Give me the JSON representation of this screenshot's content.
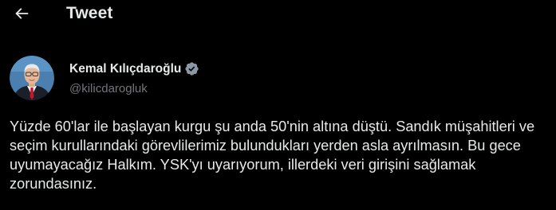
{
  "header": {
    "back_icon": "arrow-left-icon",
    "title": "Tweet"
  },
  "author": {
    "display_name": "Kemal Kılıçdaroğlu",
    "handle": "@kilicdarogluk",
    "verified_icon": "verified-badge-icon",
    "verified_color": "#8b98a5",
    "avatar_icon": "profile-photo"
  },
  "tweet": {
    "text": "Yüzde 60'lar ile başlayan kurgu şu anda 50'nin altına düştü. Sandık müşahitleri ve seçim kurullarındaki görevlilerimiz bulundukları yerden asla ayrılmasın. Bu gece uyumayacağız Halkım. YSK'yı uyarıyorum, illerdeki veri girişini sağlamak zorundasınız."
  },
  "colors": {
    "background": "#000000",
    "primary_text": "#e7e9ea",
    "secondary_text": "#71767b"
  }
}
